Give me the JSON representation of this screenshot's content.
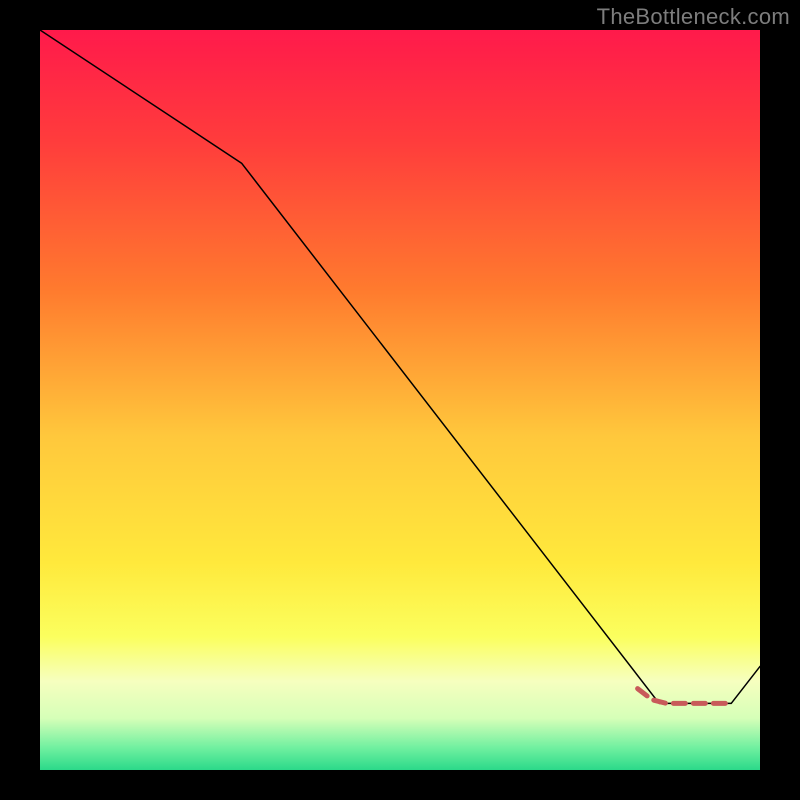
{
  "watermark": "TheBottleneck.com",
  "chart_data": {
    "type": "line",
    "title": "",
    "xlabel": "",
    "ylabel": "",
    "xlim": [
      0,
      100
    ],
    "ylim": [
      0,
      100
    ],
    "grid": false,
    "legend": false,
    "series": [
      {
        "name": "black-curve",
        "x": [
          0,
          28,
          86,
          96,
          100
        ],
        "values": [
          100,
          82,
          9,
          9,
          14
        ],
        "color": "#000000",
        "style": "solid",
        "width": 1.5
      },
      {
        "name": "red-dashed-segment",
        "x": [
          83,
          85,
          87,
          96
        ],
        "values": [
          11,
          9.5,
          9,
          9
        ],
        "color": "#c85a5a",
        "style": "dashed",
        "width": 5
      }
    ],
    "background_gradient": {
      "stops": [
        {
          "offset": 0.0,
          "color": "#ff1a4b"
        },
        {
          "offset": 0.15,
          "color": "#ff3c3c"
        },
        {
          "offset": 0.35,
          "color": "#ff7a2e"
        },
        {
          "offset": 0.55,
          "color": "#ffc83c"
        },
        {
          "offset": 0.72,
          "color": "#ffe93c"
        },
        {
          "offset": 0.82,
          "color": "#fbff5e"
        },
        {
          "offset": 0.88,
          "color": "#f6ffbf"
        },
        {
          "offset": 0.93,
          "color": "#d6ffb8"
        },
        {
          "offset": 0.97,
          "color": "#70f0a0"
        },
        {
          "offset": 1.0,
          "color": "#2bd98a"
        }
      ]
    }
  }
}
